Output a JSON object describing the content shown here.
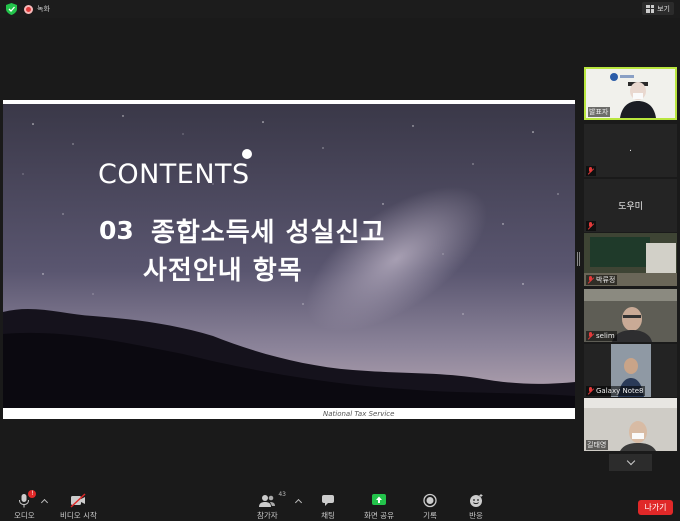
{
  "topbar": {
    "recording_label": "녹화",
    "view_label": "보기"
  },
  "slide": {
    "heading": "CONTENTS",
    "number": "03",
    "title_line1": "종합소득세 성실신고",
    "title_line2": "사전안내 항목",
    "footer": "National Tax Service"
  },
  "participants": [
    {
      "name": "발표자",
      "muted": false,
      "video": true
    },
    {
      "center_text": ".",
      "muted": true,
      "video": false
    },
    {
      "center_text": "도우미",
      "muted": true,
      "video": false
    },
    {
      "name": "박류정",
      "muted": true,
      "video": true
    },
    {
      "name": "selim",
      "muted": true,
      "video": true
    },
    {
      "name": "Galaxy Note8",
      "muted": true,
      "video": true
    },
    {
      "name": "길태영",
      "muted": false,
      "video": true
    }
  ],
  "toolbar": {
    "audio": "오디오",
    "audio_badge": "!",
    "video": "비디오 시작",
    "participants": "참가자",
    "participants_count": "43",
    "chat": "채팅",
    "share": "화면 공유",
    "record": "기록",
    "reactions": "반응",
    "leave": "나가기"
  },
  "colors": {
    "share_green": "#23c34b",
    "leave_red": "#e02828",
    "active_speaker": "#b9e63f"
  }
}
